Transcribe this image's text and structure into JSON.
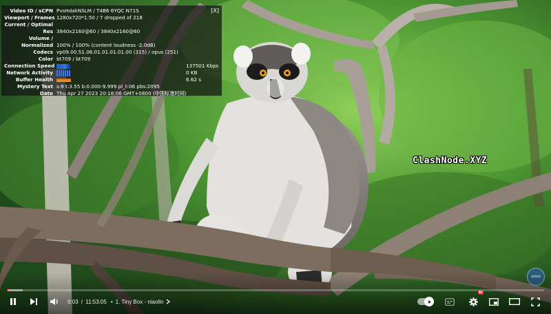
{
  "stats": {
    "close_label": "[X]",
    "rows": [
      {
        "label": "Video ID / sCPN",
        "value": "PvsHdakNSLM / T4B6 6YQC N71S"
      },
      {
        "label": "Viewport / Frames",
        "value": "1280x720*1.50 / 7 dropped of 218"
      },
      {
        "label": "Current / Optimal",
        "value": ""
      },
      {
        "label": "Res",
        "value": "3840x2160@60 / 3840x2160@60"
      },
      {
        "label": "Volume /",
        "value": ""
      },
      {
        "label": "Normalized",
        "value": "100% / 100% (content loudness -2.0dB)"
      },
      {
        "label": "Codecs",
        "value": "vp09.00.51.08.01.01.01.01.00 (315) / opus (251)"
      },
      {
        "label": "Color",
        "value": "bt709 / bt709"
      }
    ],
    "graph_rows": [
      {
        "label": "Connection Speed",
        "value": "137501 Kbps",
        "graph": "speed"
      },
      {
        "label": "Network Activity",
        "value": "0 KB",
        "graph": "network"
      },
      {
        "label": "Buffer Health",
        "value": "6.62 s",
        "graph": "buffer"
      }
    ],
    "tail_rows": [
      {
        "label": "Mystery Text",
        "value": "s:8 t:3.55 b:0.000-9.999 pl_t:06 pbs:2095"
      },
      {
        "label": "Date",
        "value": "Thu Apr 27 2023 20:18:06 GMT+0800 (中国标准时间)"
      }
    ]
  },
  "watermark": "ClashNode.XYZ",
  "branding": {
    "label": "airbnb",
    "icon": "channel-logo"
  },
  "player": {
    "progress_played_fraction": 0.0004,
    "progress_loaded_fraction": 0.03,
    "time_current": "0:03",
    "time_separator": "/",
    "time_total": "11:53:05",
    "chapter_bullet": "•",
    "chapter_title": "1. Tiny Box - niaolin",
    "settings_badge": "4K",
    "colors": {
      "progress": "#ff0000",
      "controls": "#ffffff"
    }
  }
}
